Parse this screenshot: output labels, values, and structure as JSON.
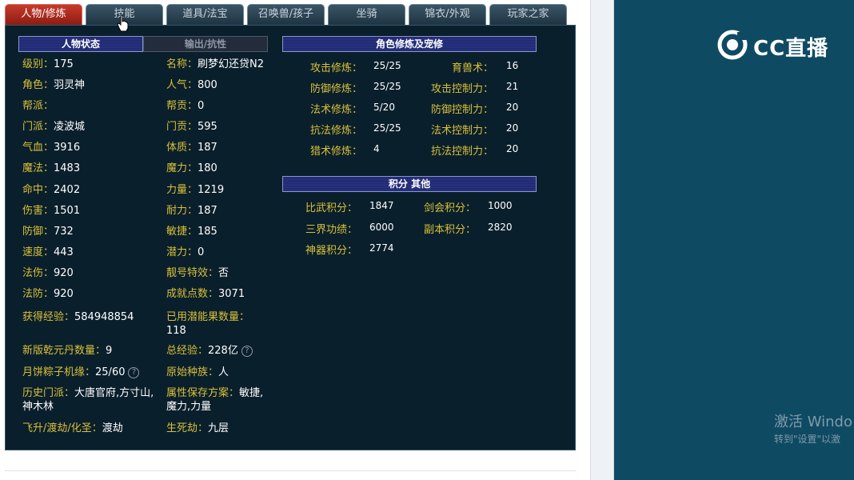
{
  "tabs": [
    "人物/修炼",
    "技能",
    "道具/法宝",
    "召唤兽/孩子",
    "坐骑",
    "锦衣/外观",
    "玩家之家"
  ],
  "sections": {
    "status_title": "人物状态",
    "resist_title": "输出/抗性",
    "cultivation_title": "角色修炼及宠修",
    "score_title": "积分 其他"
  },
  "left_col": [
    {
      "k": "级别：",
      "v": "175"
    },
    {
      "k": "角色：",
      "v": "羽灵神"
    },
    {
      "k": "帮派：",
      "v": ""
    },
    {
      "k": "门派：",
      "v": "凌波城"
    },
    {
      "k": "气血：",
      "v": "3916"
    },
    {
      "k": "魔法：",
      "v": "1483"
    },
    {
      "k": "命中：",
      "v": "2402"
    },
    {
      "k": "伤害：",
      "v": "1501"
    },
    {
      "k": "防御：",
      "v": "732"
    },
    {
      "k": "速度：",
      "v": "443"
    },
    {
      "k": "法伤：",
      "v": "920"
    },
    {
      "k": "法防：",
      "v": "920"
    },
    {
      "k": "获得经验：",
      "v": "584948854"
    },
    {
      "k": "新版乾元丹数量：",
      "v": "9"
    },
    {
      "k": "月饼粽子机缘：",
      "v": "25/60"
    },
    {
      "k": "历史门派：",
      "v": "大唐官府,方寸山,神木林"
    },
    {
      "k": "飞升/渡劫/化圣：",
      "v": "渡劫"
    }
  ],
  "mid_col": [
    {
      "k": "名称：",
      "v": "刷梦幻还贷N2"
    },
    {
      "k": "人气：",
      "v": "800"
    },
    {
      "k": "帮贡：",
      "v": "0"
    },
    {
      "k": "门贡：",
      "v": "595"
    },
    {
      "k": "体质：",
      "v": "187"
    },
    {
      "k": "魔力：",
      "v": "180"
    },
    {
      "k": "力量：",
      "v": "1219"
    },
    {
      "k": "耐力：",
      "v": "187"
    },
    {
      "k": "敏捷：",
      "v": "185"
    },
    {
      "k": "潜力：",
      "v": "0"
    },
    {
      "k": "靓号特效：",
      "v": "否"
    },
    {
      "k": "成就点数：",
      "v": "3071"
    },
    {
      "k": "已用潜能果数量：",
      "v": "118"
    },
    {
      "k": "总经验：",
      "v": "228亿"
    },
    {
      "k": "原始种族：",
      "v": "人"
    },
    {
      "k": "属性保存方案：",
      "v": "敏捷,魔力,力量"
    },
    {
      "k": "生死劫：",
      "v": "九层"
    }
  ],
  "cultivation": [
    {
      "k1": "攻击修炼：",
      "v1": "25/25",
      "k2": "育兽术：",
      "v2": "16"
    },
    {
      "k1": "防御修炼：",
      "v1": "25/25",
      "k2": "攻击控制力：",
      "v2": "21"
    },
    {
      "k1": "法术修炼：",
      "v1": "5/20",
      "k2": "防御控制力：",
      "v2": "20"
    },
    {
      "k1": "抗法修炼：",
      "v1": "25/25",
      "k2": "法术控制力：",
      "v2": "20"
    },
    {
      "k1": "猎术修炼：",
      "v1": "4",
      "k2": "抗法控制力：",
      "v2": "20"
    }
  ],
  "scores": [
    {
      "k1": "比武积分：",
      "v1": "1847",
      "k2": "剑会积分：",
      "v2": "1000"
    },
    {
      "k1": "三界功绩：",
      "v1": "6000",
      "k2": "副本积分：",
      "v2": "2820"
    },
    {
      "k1": "神器积分：",
      "v1": "2774",
      "k2": "",
      "v2": ""
    }
  ],
  "help_glyph": "?",
  "logo_text": "CC直播",
  "watermark": {
    "line1": "激活 Windo",
    "line2": "转到\"设置\"以激"
  },
  "colors": {
    "label": "#d8c038",
    "value": "#ffffff",
    "panel": "#0a1f2c",
    "active_tab": "#c63a2c"
  }
}
